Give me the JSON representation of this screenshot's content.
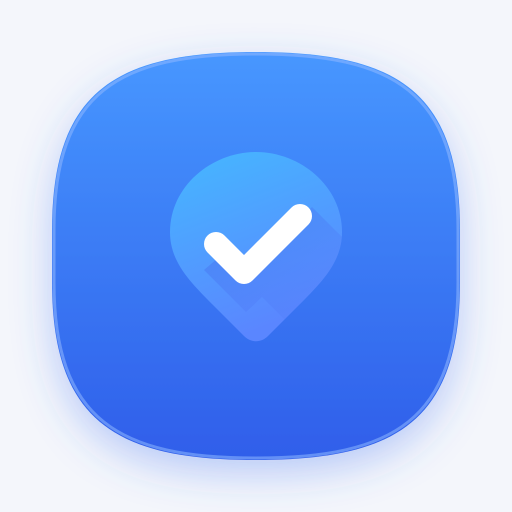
{
  "app_icon": {
    "icon": "location-check-icon",
    "colors": {
      "background": "#f4f6fb",
      "tile_top": "#4797ff",
      "tile_bottom": "#2f5eea",
      "tile_rim": "#8fb8ff",
      "pin_top": "#45b8ff",
      "pin_bottom": "#5a86ff",
      "check": "#ffffff",
      "long_shadow": "#4a6ff0"
    }
  }
}
